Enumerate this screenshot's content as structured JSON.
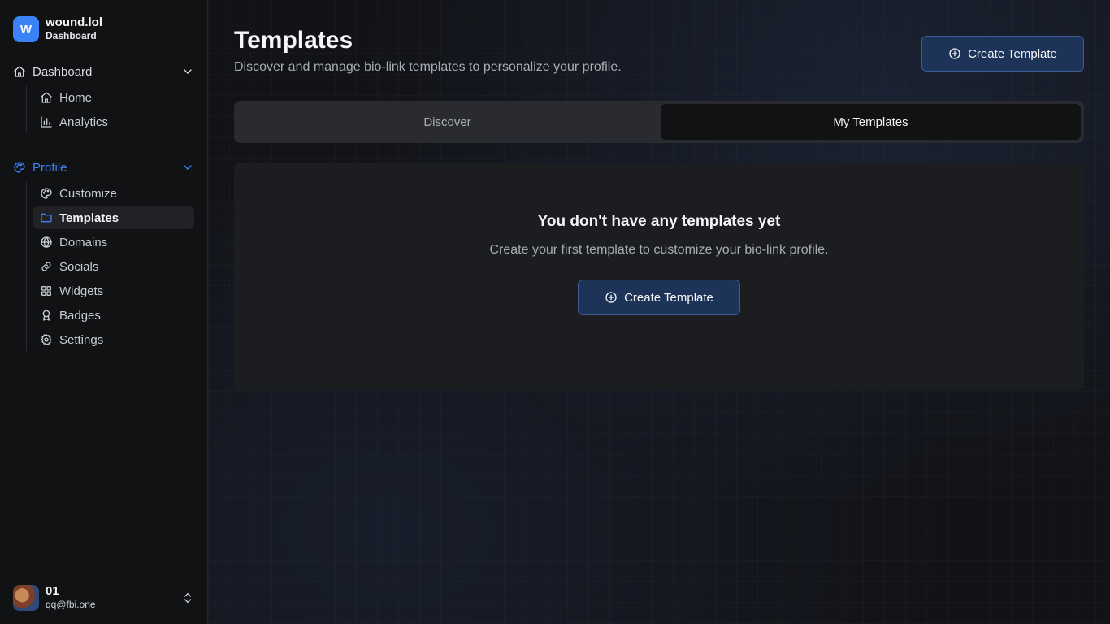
{
  "brand": {
    "logo_letter": "W",
    "name": "wound.lol",
    "subtitle": "Dashboard"
  },
  "sidebar": {
    "groups": [
      {
        "label": "Dashboard",
        "icon": "house-icon",
        "active": false,
        "items": [
          {
            "label": "Home",
            "icon": "house-icon",
            "selected": false
          },
          {
            "label": "Analytics",
            "icon": "bar-chart-icon",
            "selected": false
          }
        ]
      },
      {
        "label": "Profile",
        "icon": "palette-icon",
        "active": true,
        "items": [
          {
            "label": "Customize",
            "icon": "palette-icon",
            "selected": false
          },
          {
            "label": "Templates",
            "icon": "folder-icon",
            "selected": true
          },
          {
            "label": "Domains",
            "icon": "globe-icon",
            "selected": false
          },
          {
            "label": "Socials",
            "icon": "link-icon",
            "selected": false
          },
          {
            "label": "Widgets",
            "icon": "grid-icon",
            "selected": false
          },
          {
            "label": "Badges",
            "icon": "award-icon",
            "selected": false
          },
          {
            "label": "Settings",
            "icon": "gear-icon",
            "selected": false
          }
        ]
      }
    ],
    "accent_color": "#3b82f6"
  },
  "user": {
    "name": "01",
    "email": "qq@fbi.one"
  },
  "page": {
    "title": "Templates",
    "description": "Discover and manage bio-link templates to personalize your profile.",
    "create_button": "Create Template"
  },
  "tabs": [
    {
      "label": "Discover",
      "active": false
    },
    {
      "label": "My Templates",
      "active": true
    }
  ],
  "empty_state": {
    "title": "You don't have any templates yet",
    "description": "Create your first template to customize your bio-link profile.",
    "button": "Create Template"
  }
}
